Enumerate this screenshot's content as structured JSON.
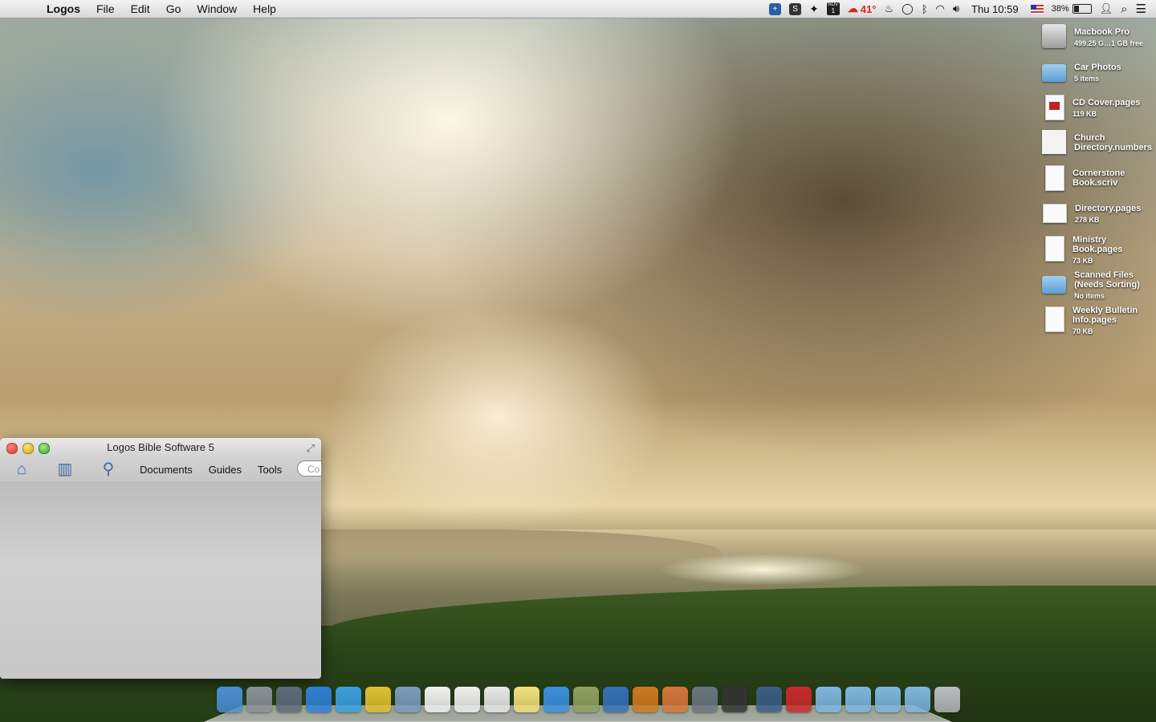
{
  "menubar": {
    "app_name": "Logos",
    "menus": [
      "File",
      "Edit",
      "Go",
      "Window",
      "Help"
    ],
    "weather": "41°",
    "calendar_month": "NOV",
    "calendar_day": "1",
    "battery": "38%",
    "battery_fraction": 0.38,
    "clock": "Thu 10:59"
  },
  "desktop_icons": [
    {
      "name": "Macbook Pro",
      "sub": "499.25 G…1 GB free",
      "icon": "hard-drive-icon"
    },
    {
      "name": "Car Photos",
      "sub": "5 items",
      "icon": "folder-icon"
    },
    {
      "name": "CD Cover.pages",
      "sub": "119 KB",
      "icon": "document-icon"
    },
    {
      "name": "Church Directory.numbers",
      "sub": "",
      "icon": "spreadsheet-icon"
    },
    {
      "name": "Cornerstone Book.scriv",
      "sub": "",
      "icon": "document-icon"
    },
    {
      "name": "Directory.pages",
      "sub": "278 KB",
      "icon": "document-icon"
    },
    {
      "name": "Ministry Book.pages",
      "sub": "73 KB",
      "icon": "document-icon"
    },
    {
      "name": "Scanned Files (Needs Sorting)",
      "sub": "No items",
      "icon": "folder-icon"
    },
    {
      "name": "Weekly Bulletin Info.pages",
      "sub": "70 KB",
      "icon": "document-icon"
    }
  ],
  "logos_window": {
    "title": "Logos Bible Software 5",
    "toolbar": {
      "documents": "Documents",
      "guides": "Guides",
      "tools": "Tools",
      "command_placeholder": "Co"
    }
  },
  "dock": {
    "apps": [
      {
        "name": "finder-icon",
        "color": "#4a8fd6"
      },
      {
        "name": "launchpad-icon",
        "color": "#8a8f98"
      },
      {
        "name": "mission-control-icon",
        "color": "#5b6b7a"
      },
      {
        "name": "app-store-icon",
        "color": "#2f7fd8"
      },
      {
        "name": "twitter-icon",
        "color": "#3aa0e0"
      },
      {
        "name": "chrome-icon",
        "color": "#e0c030"
      },
      {
        "name": "mail-icon",
        "color": "#7c9ac0"
      },
      {
        "name": "calendar-icon",
        "color": "#f2f2f2"
      },
      {
        "name": "reminders-icon",
        "color": "#f0f0f0"
      },
      {
        "name": "textedit-icon",
        "color": "#e8e8e8"
      },
      {
        "name": "notes-icon",
        "color": "#f2e07a"
      },
      {
        "name": "itunes-icon",
        "color": "#3a8fdf"
      },
      {
        "name": "iphoto-icon",
        "color": "#8fa060"
      },
      {
        "name": "logos-icon",
        "color": "#3470b8"
      },
      {
        "name": "logos-flame-icon",
        "color": "#d0781e"
      },
      {
        "name": "keynote-icon",
        "color": "#d8753a"
      },
      {
        "name": "script-editor-icon",
        "color": "#6a7580"
      },
      {
        "name": "scrivener-icon",
        "color": "#333333"
      }
    ],
    "stacks": [
      {
        "name": "desktop-stack-icon",
        "color": "#3b5c84"
      },
      {
        "name": "bookmark-stack-icon",
        "color": "#c82a2a"
      },
      {
        "name": "documents-folder-icon",
        "color": "#7fb6e0"
      },
      {
        "name": "applications-folder-icon",
        "color": "#7fb6e0"
      },
      {
        "name": "downloads-folder-icon",
        "color": "#7fb6e0"
      },
      {
        "name": "dropbox-folder-icon",
        "color": "#7fb6e0"
      },
      {
        "name": "trash-icon",
        "color": "#b8bcc0"
      }
    ]
  }
}
